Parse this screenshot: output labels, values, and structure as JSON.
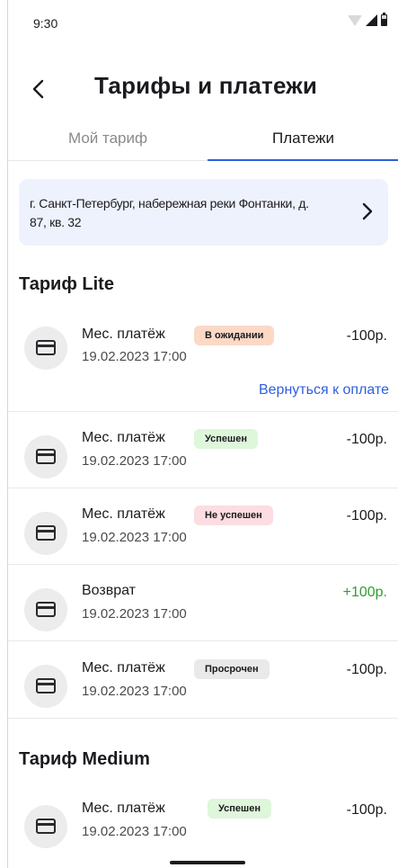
{
  "status_bar": {
    "time": "9:30"
  },
  "header": {
    "title": "Тарифы и платежи"
  },
  "tabs": [
    {
      "label": "Мой тариф",
      "active": false
    },
    {
      "label": "Платежи",
      "active": true
    }
  ],
  "address": {
    "text": "г. Санкт-Петербург, набережная реки Фонтанки, д. 87, кв. 32"
  },
  "sections": [
    {
      "title": "Тариф Lite",
      "payments": [
        {
          "label": "Мес. платёж",
          "status": "В ожидании",
          "status_type": "pending",
          "date": "19.02.2023 17:00",
          "amount": "-100р.",
          "action": "Вернуться к оплате"
        },
        {
          "label": "Мес. платёж",
          "status": "Успешен",
          "status_type": "success",
          "date": "19.02.2023 17:00",
          "amount": "-100р."
        },
        {
          "label": "Мес. платёж",
          "status": "Не успешен",
          "status_type": "failed",
          "date": "19.02.2023 17:00",
          "amount": "-100р."
        },
        {
          "label": "Возврат",
          "status": "",
          "status_type": "",
          "date": "19.02.2023 17:00",
          "amount": "+100р."
        },
        {
          "label": "Мес. платёж",
          "status": "Просрочен",
          "status_type": "overdue",
          "date": "19.02.2023 17:00",
          "amount": "-100р."
        }
      ]
    },
    {
      "title": "Тариф Medium",
      "payments": [
        {
          "label": "Мес. платёж",
          "status": "Успешен",
          "status_type": "success",
          "date": "19.02.2023 17:00",
          "amount": "-100р."
        }
      ]
    }
  ],
  "colors": {
    "accent": "#2f5fe0",
    "positive_amount": "#2ea02e",
    "address_bg": "#eef2fd",
    "badge_pending": "#fbd9c6",
    "badge_success": "#def6da",
    "badge_failed": "#fbdde2",
    "badge_overdue": "#e9e9e9"
  },
  "icons": {
    "back": "arrow-left-icon",
    "address_chevron": "chevron-right-icon",
    "payment": "credit-card-icon"
  }
}
